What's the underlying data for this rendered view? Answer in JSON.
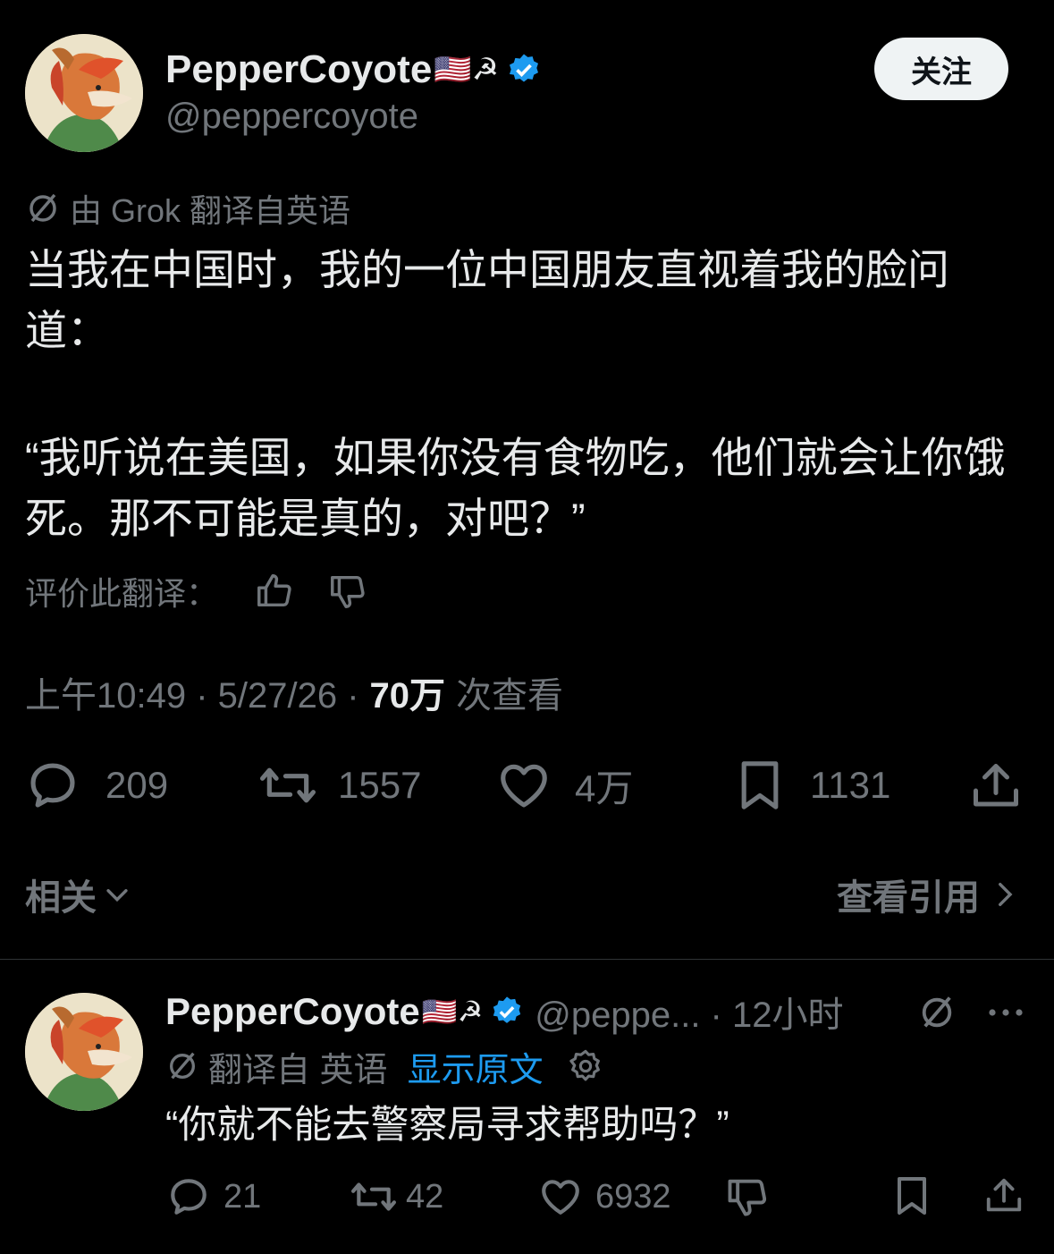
{
  "post": {
    "display_name": "PepperCoyote",
    "name_emoji": "🇺🇸☭",
    "handle": "@peppercoyote",
    "follow_label": "关注",
    "translation_note": "由 Grok 翻译自英语",
    "paragraph1": "当我在中国时，我的一位中国朋友直视着我的脸问道：",
    "paragraph2": "“我听说在美国，如果你没有食物吃，他们就会让你饿死。那不可能是真的，对吧？”",
    "rate_label": "评价此翻译：",
    "timestamp": "上午10:49 · 5/27/26 ·",
    "views_count": "70万",
    "views_label": "次查看",
    "stats": {
      "replies": "209",
      "reposts": "1557",
      "likes": "4万",
      "bookmarks": "1131"
    },
    "related_label": "相关",
    "view_quotes_label": "查看引用"
  },
  "reply": {
    "display_name": "PepperCoyote",
    "name_emoji": "🇺🇸☭",
    "handle_time": "@peppe... · 12小时",
    "translated_from": "翻译自 英语",
    "show_original": "显示原文",
    "text": "“你就不能去警察局寻求帮助吗？”",
    "stats": {
      "replies": "21",
      "reposts": "42",
      "likes": "6932"
    }
  },
  "colors": {
    "background": "#000000",
    "text": "#e7e9ea",
    "muted": "#71767b",
    "verified": "#1d9bf0",
    "link": "#1d9bf0"
  },
  "icons": [
    "verified-badge-icon",
    "translate-icon",
    "thumbs-up-icon",
    "thumbs-down-icon",
    "reply-icon",
    "repost-icon",
    "like-icon",
    "bookmark-icon",
    "share-icon",
    "chevron-down-icon",
    "chevron-right-icon",
    "gear-icon",
    "more-icon"
  ]
}
